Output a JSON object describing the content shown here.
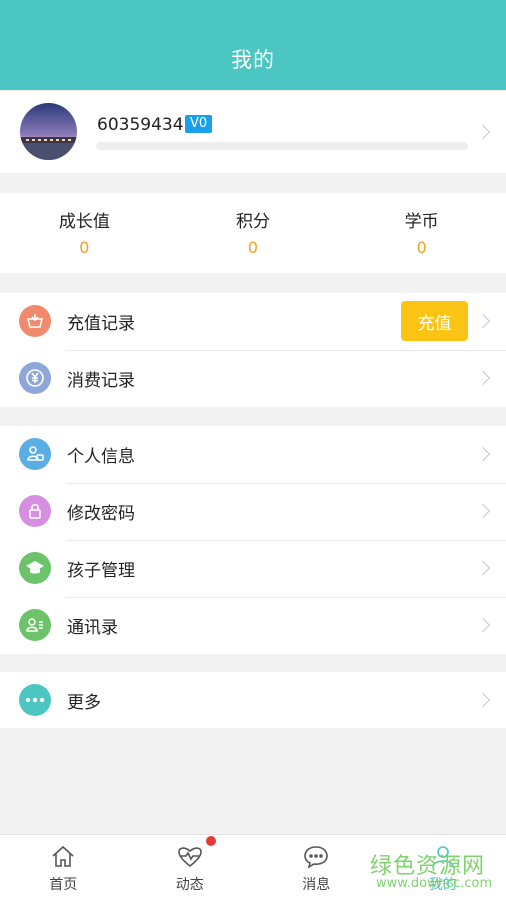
{
  "header": {
    "title": "我的"
  },
  "profile": {
    "user_id": "60359434",
    "level": "V0",
    "progress": 0
  },
  "stats": [
    {
      "label": "成长值",
      "value": "0"
    },
    {
      "label": "积分",
      "value": "0"
    },
    {
      "label": "学币",
      "value": "0"
    }
  ],
  "groups": {
    "records": [
      {
        "label": "充值记录",
        "icon": "basket-icon",
        "color": "#f08a6c"
      },
      {
        "label": "消费记录",
        "icon": "yen-icon",
        "color": "#8fa6d8"
      }
    ],
    "recharge_button": "充值",
    "account": [
      {
        "label": "个人信息",
        "icon": "person-card-icon",
        "color": "#5aaee6"
      },
      {
        "label": "修改密码",
        "icon": "lock-icon",
        "color": "#d68ee0"
      },
      {
        "label": "孩子管理",
        "icon": "graduation-cap-icon",
        "color": "#6cc36a"
      },
      {
        "label": "通讯录",
        "icon": "contacts-icon",
        "color": "#6cc36a"
      }
    ],
    "more": [
      {
        "label": "更多",
        "icon": "more-dots-icon",
        "color": "#4cc6c2"
      }
    ]
  },
  "tabbar": [
    {
      "label": "首页",
      "icon": "home-icon"
    },
    {
      "label": "动态",
      "icon": "heart-pulse-icon"
    },
    {
      "label": "消息",
      "icon": "chat-icon"
    },
    {
      "label": "我的",
      "icon": "profile-icon"
    }
  ],
  "colors": {
    "accent": "#4cc6c2",
    "badge": "#1aa0e8",
    "value": "#f0a020",
    "button": "#fbc414"
  },
  "watermark": {
    "text": "绿色资源网",
    "sub": "www.downcc.com"
  }
}
